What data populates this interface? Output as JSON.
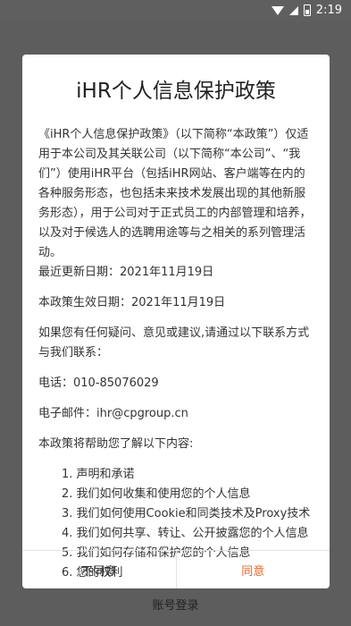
{
  "status": {
    "time": "2:19"
  },
  "background": {
    "bottom_link": "账号登录"
  },
  "dialog": {
    "title": "iHR个人信息保护政策",
    "intro": "《iHR个人信息保护政策》（以下简称“本政策”）仅适用于本公司及其关联公司（以下简称“本公司”、“我们”）使用iHR平台（包括iHR网站、客户端等在内的各种服务形态，也包括未来技术发展出现的其他新服务形态），用于公司对于正式员工的内部管理和培养，以及对于候选人的选聘用途等与之相关的系列管理活动。",
    "updated": "最近更新日期：2021年11月19日",
    "effective": "本政策生效日期：2021年11月19日",
    "contact_text": "如果您有任何疑问、意见或建议,请通过以下联系方式与我们联系：",
    "phone": "电话：010-85076029",
    "email": "电子邮件：ihr@cpgroup.cn",
    "help_text": "本政策将帮助您了解以下内容:",
    "items": [
      "1. 声明和承诺",
      "2. 我们如何收集和使用您的个人信息",
      "3. 我们如何使用Cookie和同类技术及Proxy技术",
      "4. 我们如何共享、转让、公开披露您的个人信息",
      "5. 我们如何存储和保护您的个人信息",
      "6. 您的权利"
    ],
    "disagree_label": "不同意",
    "agree_label": "同意"
  }
}
